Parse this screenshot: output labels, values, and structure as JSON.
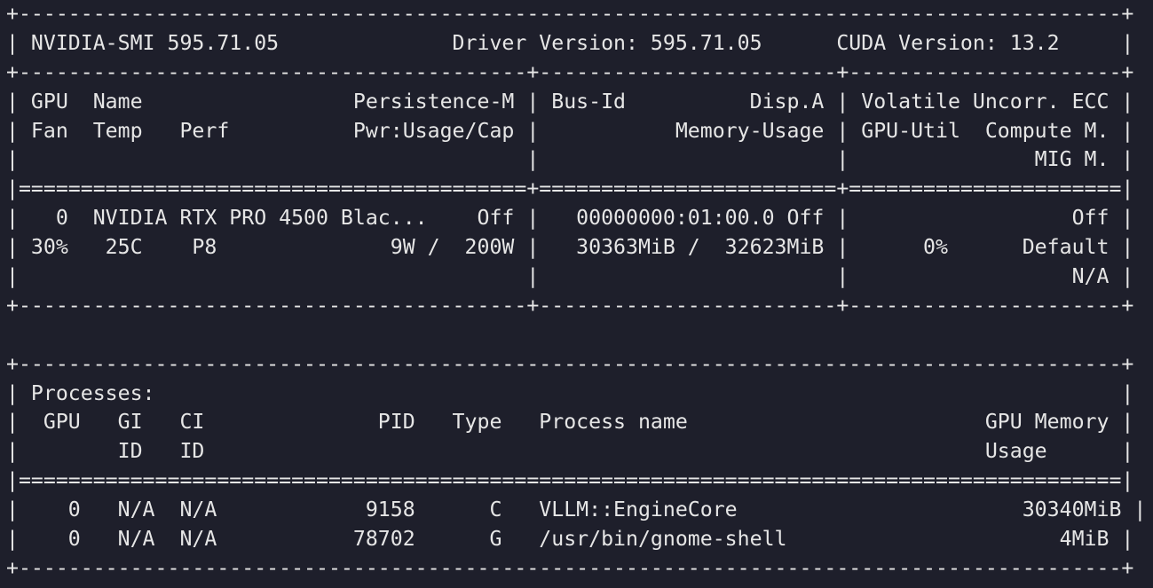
{
  "terminal": {
    "lines": [
      "+-----------------------------------------------------------------------------------------+",
      "| NVIDIA-SMI 595.71.05              Driver Version: 595.71.05      CUDA Version: 13.2     |",
      "+-----------------------------------------+------------------------+----------------------+",
      "| GPU  Name                 Persistence-M | Bus-Id          Disp.A | Volatile Uncorr. ECC |",
      "| Fan  Temp   Perf          Pwr:Usage/Cap |           Memory-Usage | GPU-Util  Compute M. |",
      "|                                         |                        |               MIG M. |",
      "|=========================================+========================+======================|",
      "|   0  NVIDIA RTX PRO 4500 Blac...    Off |   00000000:01:00.0 Off |                  Off |",
      "| 30%   25C    P8              9W /  200W |   30363MiB /  32623MiB |      0%      Default |",
      "|                                         |                        |                  N/A |",
      "+-----------------------------------------+------------------------+----------------------+",
      "",
      "+-----------------------------------------------------------------------------------------+",
      "| Processes:                                                                              |",
      "|  GPU   GI   CI              PID   Type   Process name                        GPU Memory |",
      "|        ID   ID                                                               Usage      |",
      "|=========================================================================================|",
      "|    0   N/A  N/A            9158      C   VLLM::EngineCore                       30340MiB |",
      "|    0   N/A  N/A           78702      G   /usr/bin/gnome-shell                      4MiB |",
      "+-----------------------------------------------------------------------------------------+"
    ]
  }
}
